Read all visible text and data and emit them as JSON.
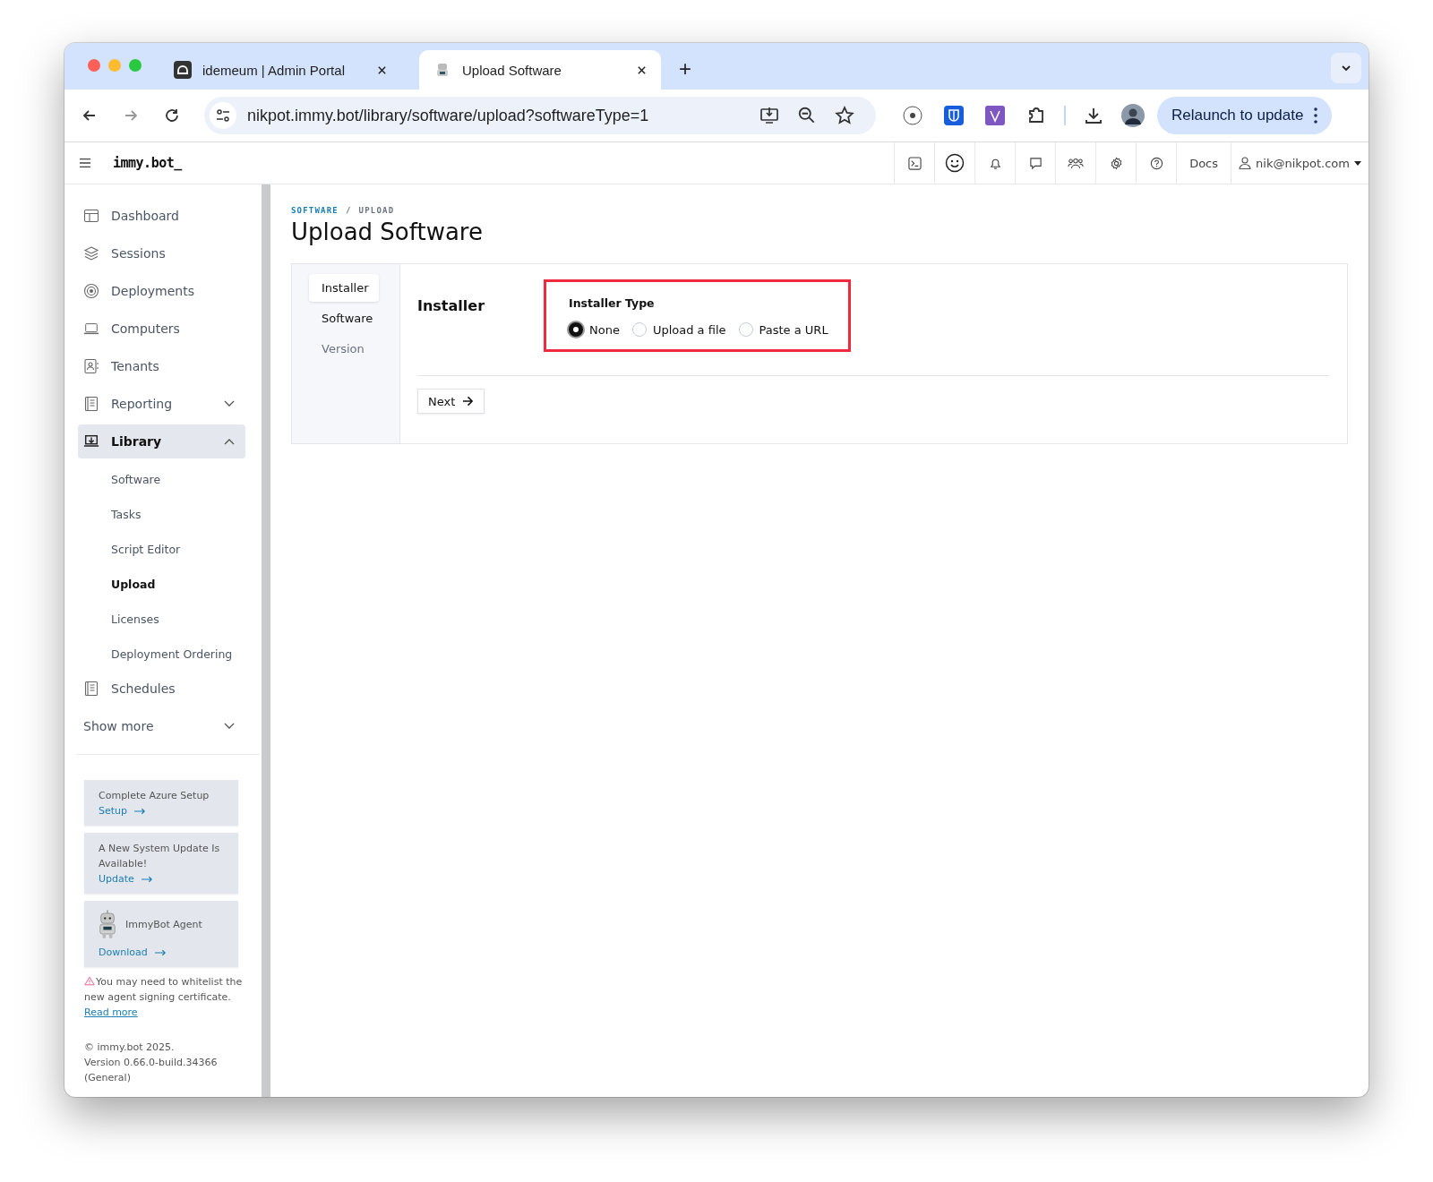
{
  "browser": {
    "tabs": [
      {
        "title": "idemeum | Admin Portal",
        "selected": false
      },
      {
        "title": "Upload Software",
        "selected": true
      }
    ],
    "new_tab": "+",
    "url": "nikpot.immy.bot/library/software/upload?softwareType=1",
    "relaunch_button": "Relaunch to update"
  },
  "app_header": {
    "logo": "immy.bot_",
    "docs": "Docs",
    "user": "nik@nikpot.com"
  },
  "sidebar": {
    "items": [
      {
        "label": "Dashboard",
        "kind": "link",
        "selected": false
      },
      {
        "label": "Sessions",
        "kind": "link",
        "selected": false
      },
      {
        "label": "Deployments",
        "kind": "link",
        "selected": false
      },
      {
        "label": "Computers",
        "kind": "link",
        "selected": false
      },
      {
        "label": "Tenants",
        "kind": "link",
        "selected": false
      },
      {
        "label": "Reporting",
        "kind": "group",
        "expanded": false,
        "selected": false
      },
      {
        "label": "Library",
        "kind": "group",
        "expanded": true,
        "selected": true,
        "children": [
          {
            "label": "Software",
            "selected": false
          },
          {
            "label": "Tasks",
            "selected": false
          },
          {
            "label": "Script Editor",
            "selected": false
          },
          {
            "label": "Upload",
            "selected": true
          },
          {
            "label": "Licenses",
            "selected": false
          },
          {
            "label": "Deployment Ordering",
            "selected": false
          }
        ]
      },
      {
        "label": "Schedules",
        "kind": "link",
        "selected": false
      },
      {
        "label": "Show more",
        "kind": "more",
        "expanded": false,
        "selected": false
      }
    ],
    "cards": [
      {
        "kind": "plain",
        "text": "Complete Azure Setup",
        "link": "Setup"
      },
      {
        "kind": "plain",
        "text": "A New System Update Is Available!",
        "link": "Update"
      },
      {
        "kind": "agent",
        "text": "ImmyBot Agent",
        "link": "Download"
      }
    ],
    "warning": {
      "text": "You may need to whitelist the new agent signing certificate.",
      "link": "Read more"
    },
    "footer": [
      "© immy.bot 2025.",
      "Version 0.66.0-build.34366",
      "(General)"
    ]
  },
  "main": {
    "breadcrumb": {
      "items": [
        "SOFTWARE",
        "UPLOAD"
      ],
      "separator": "/"
    },
    "title": "Upload Software",
    "steps": [
      {
        "label": "Installer",
        "selected": true,
        "disabled": false
      },
      {
        "label": "Software",
        "selected": false,
        "disabled": false
      },
      {
        "label": "Version",
        "selected": false,
        "disabled": true
      }
    ],
    "section_title": "Installer",
    "field": {
      "label": "Installer Type",
      "highlighted": true,
      "options": [
        {
          "label": "None",
          "selected": true
        },
        {
          "label": "Upload a file",
          "selected": false
        },
        {
          "label": "Paste a URL",
          "selected": false
        }
      ]
    },
    "next_button": "Next"
  }
}
